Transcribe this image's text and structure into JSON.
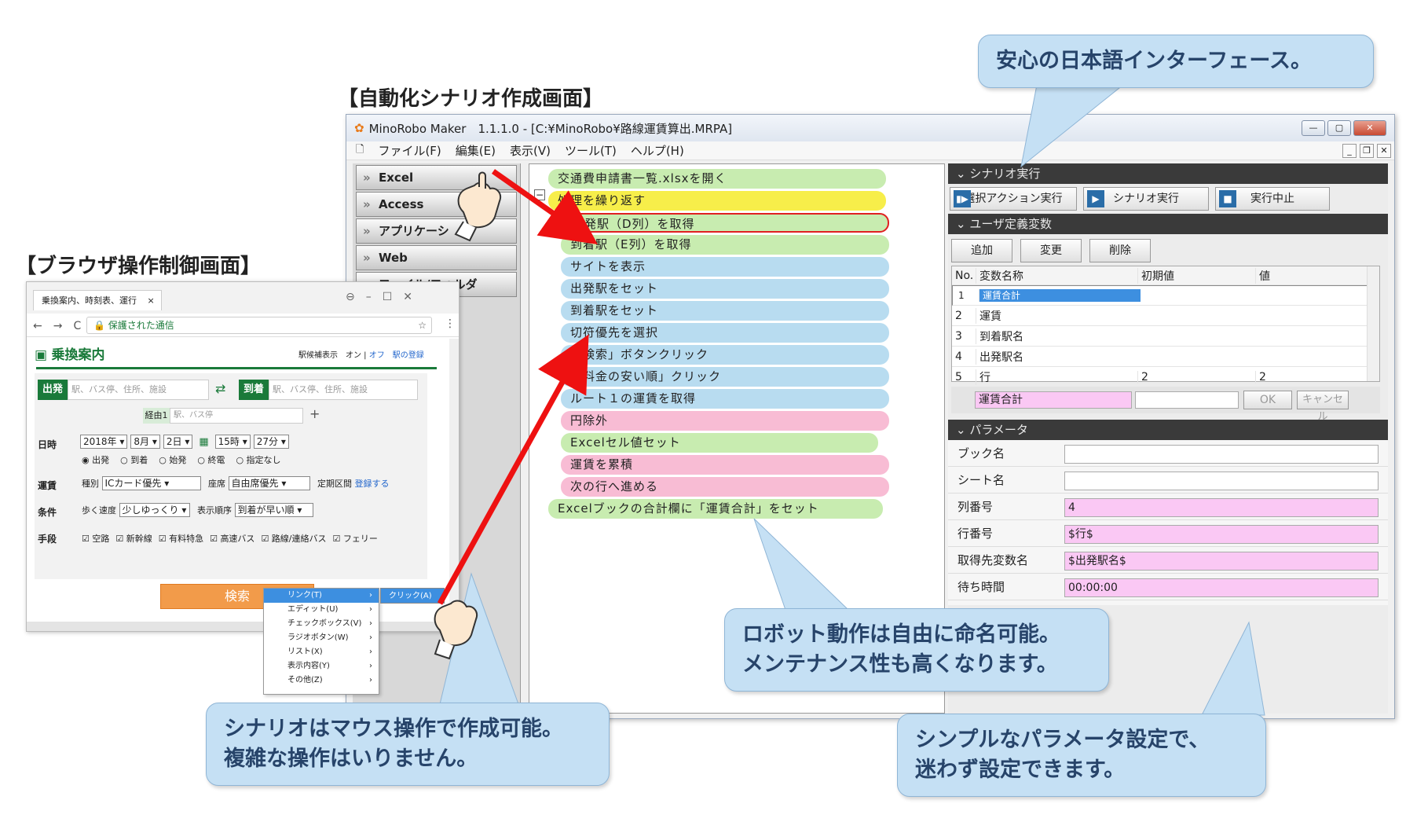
{
  "titles": {
    "scenario": "【自動化シナリオ作成画面】",
    "browser": "【ブラウザ操作制御画面】"
  },
  "app": {
    "title": "MinoRobo Maker　1.1.1.0 - [C:¥MinoRobo¥路線運賃算出.MRPA]",
    "menu": [
      "ファイル(F)",
      "編集(E)",
      "表示(V)",
      "ツール(T)",
      "ヘルプ(H)"
    ],
    "categories": [
      "Excel",
      "Access",
      "アプリケーシ",
      "Web",
      "ファイル/フォルダ"
    ],
    "steps": [
      {
        "text": "交通費申請書一覧.xlsxを開く",
        "color": "g"
      },
      {
        "text": "処理を繰り返す",
        "color": "y"
      },
      {
        "text": "出発駅（D列）を取得",
        "color": "g"
      },
      {
        "text": "到着駅（E列）を取得",
        "color": "g"
      },
      {
        "text": "サイトを表示",
        "color": "b"
      },
      {
        "text": "出発駅をセット",
        "color": "b"
      },
      {
        "text": "到着駅をセット",
        "color": "b"
      },
      {
        "text": "切符優先を選択",
        "color": "b"
      },
      {
        "text": "「検索」ボタンクリック",
        "color": "b"
      },
      {
        "text": "「料金の安い順」クリック",
        "color": "b"
      },
      {
        "text": "ルート１の運賃を取得",
        "color": "b"
      },
      {
        "text": "円除外",
        "color": "p"
      },
      {
        "text": "Excelセル値セット",
        "color": "g"
      },
      {
        "text": "運賃を累積",
        "color": "p"
      },
      {
        "text": "次の行へ進める",
        "color": "p"
      },
      {
        "text": "Excelブックの合計欄に「運賃合計」をセット",
        "color": "g"
      }
    ],
    "collapse_icon": "−",
    "scenario_section": "シナリオ実行",
    "run_buttons": [
      "選択アクション実行",
      "シナリオ実行",
      "実行中止"
    ],
    "vars_section": "ユーザ定義変数",
    "var_buttons": [
      "追加",
      "変更",
      "削除"
    ],
    "var_headers": [
      "No.",
      "変数名称",
      "初期値",
      "値"
    ],
    "vars": [
      [
        "1",
        "運賃合計",
        "",
        ""
      ],
      [
        "2",
        "運賃",
        "",
        ""
      ],
      [
        "3",
        "到着駅名",
        "",
        ""
      ],
      [
        "4",
        "出発駅名",
        "",
        ""
      ],
      [
        "5",
        "行",
        "2",
        "2"
      ]
    ],
    "edit_value": "運賃合計",
    "ok": "OK",
    "cancel": "キャンセル",
    "param_section": "パラメータ",
    "params": [
      {
        "label": "ブック名",
        "value": "",
        "pink": false
      },
      {
        "label": "シート名",
        "value": "",
        "pink": false
      },
      {
        "label": "列番号",
        "value": "4",
        "pink": true
      },
      {
        "label": "行番号",
        "value": "$行$",
        "pink": true
      },
      {
        "label": "取得先変数名",
        "value": "$出発駅名$",
        "pink": true
      },
      {
        "label": "待ち時間",
        "value": "00:00:00",
        "pink": true
      }
    ]
  },
  "browser": {
    "tab": "乗換案内、時刻表、運行",
    "url": "保護された通信",
    "brand": "乗換案内",
    "station_display": "駅候補表示",
    "on": "オン",
    "off": "オフ",
    "register_station": "駅の登録",
    "from_label": "出発",
    "to_label": "到着",
    "station_placeholder": "駅、バス停、住所、施設",
    "via_label": "経由1",
    "via_placeholder": "駅、バス停",
    "date_label": "日時",
    "year": "2018年",
    "month": "8月",
    "day": "2日",
    "hour": "15時",
    "minute": "27分",
    "time_options": [
      "出発",
      "到着",
      "始発",
      "終電",
      "指定なし"
    ],
    "fare_label": "運賃",
    "kind_label": "種別",
    "kind_value": "ICカード優先",
    "seat_label": "座席",
    "seat_value": "自由席優先",
    "pass_label": "定期区間",
    "pass_link": "登録する",
    "cond_label": "条件",
    "walk_label": "歩く速度",
    "walk_value": "少しゆっくり",
    "order_label": "表示順序",
    "order_value": "到着が早い順",
    "means_label": "手段",
    "means": [
      "空路",
      "新幹線",
      "有料特急",
      "高速バス",
      "路線/連絡バス",
      "フェリー"
    ],
    "search": "検索",
    "context_menu": [
      "リンク(T)",
      "エディット(U)",
      "チェックボックス(V)",
      "ラジオボタン(W)",
      "リスト(X)",
      "表示内容(Y)",
      "その他(Z)"
    ],
    "submenu": "クリック(A)"
  },
  "callouts": {
    "top": "安心の日本語インターフェース。",
    "mid": [
      "ロボット動作は自由に命名可能。",
      "メンテナンス性も高くなります。"
    ],
    "left": [
      "シナリオはマウス操作で作成可能。",
      "複雑な操作はいりません。"
    ],
    "right": [
      "シンプルなパラメータ設定で、",
      "迷わず設定できます。"
    ]
  },
  "colors": {
    "callout_bg": "#c5e0f4",
    "callout_text": "#27446a",
    "arrow": "#ee1111",
    "accent": "#3d8fe0"
  }
}
